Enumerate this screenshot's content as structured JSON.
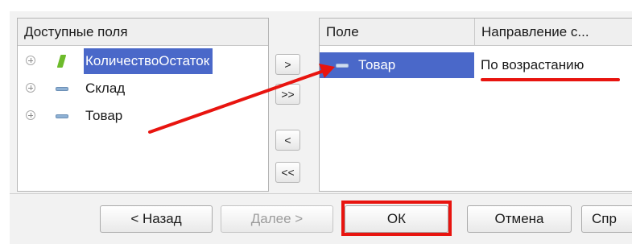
{
  "available_fields": {
    "header": "Доступные поля",
    "items": [
      {
        "label": "КоличествоОстаток",
        "icon": "resource-leaf-icon",
        "selected": true
      },
      {
        "label": "Склад",
        "icon": "dimension-dash-icon",
        "selected": false
      },
      {
        "label": "Товар",
        "icon": "dimension-dash-icon",
        "selected": false
      }
    ]
  },
  "transfer_buttons": {
    "add": ">",
    "add_all": ">>",
    "remove": "<",
    "remove_all": "<<"
  },
  "order_table": {
    "columns": [
      "Поле",
      "Направление с..."
    ],
    "rows": [
      {
        "field": "Товар",
        "direction": "По возрастанию"
      }
    ]
  },
  "footer": {
    "back_label": "< Назад",
    "next_label": "Далее >",
    "ok_label": "ОК",
    "cancel_label": "Отмена",
    "help_label": "Спр"
  },
  "colors": {
    "selection": "#4a68c9",
    "annotation_red": "#e8140f"
  }
}
